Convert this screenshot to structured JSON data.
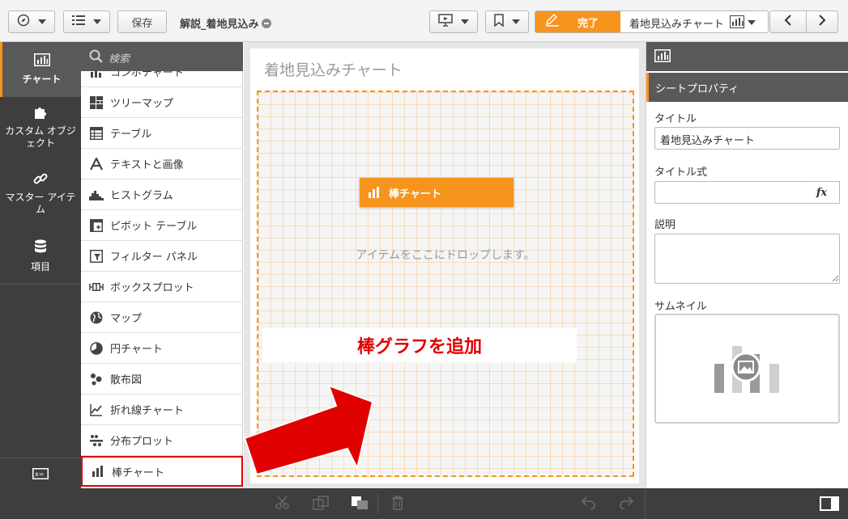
{
  "toolbar": {
    "explore_icon": "compass-icon",
    "menu_icon": "list-menu-icon",
    "save_label": "保存",
    "app_title": "解説_着地見込み",
    "present_icon": "presentation-icon",
    "bookmark_icon": "bookmark-icon",
    "edit_icon": "pencil-icon",
    "done_label": "完了",
    "sheet_name": "着地見込みチャート",
    "sheet_icon": "bar-chart-icon",
    "prev_icon": "chevron-left-icon",
    "next_icon": "chevron-right-icon"
  },
  "leftnav": {
    "items": [
      {
        "label": "チャート",
        "icon": "bar-chart-icon"
      },
      {
        "label": "カスタム オブジェクト",
        "icon": "puzzle-icon"
      },
      {
        "label": "マスター アイテム",
        "icon": "link-icon"
      },
      {
        "label": "項目",
        "icon": "database-icon"
      }
    ]
  },
  "list": {
    "search_placeholder": "検索",
    "items": [
      {
        "label": "コンボチャート",
        "icon": "combo-chart-icon"
      },
      {
        "label": "ツリーマップ",
        "icon": "treemap-icon"
      },
      {
        "label": "テーブル",
        "icon": "table-icon"
      },
      {
        "label": "テキストと画像",
        "icon": "text-image-icon"
      },
      {
        "label": "ヒストグラム",
        "icon": "histogram-icon"
      },
      {
        "label": "ピボット テーブル",
        "icon": "pivot-table-icon"
      },
      {
        "label": "フィルター パネル",
        "icon": "filter-pane-icon"
      },
      {
        "label": "ボックスプロット",
        "icon": "boxplot-icon"
      },
      {
        "label": "マップ",
        "icon": "globe-icon"
      },
      {
        "label": "円チャート",
        "icon": "pie-chart-icon"
      },
      {
        "label": "散布図",
        "icon": "scatter-plot-icon"
      },
      {
        "label": "折れ線チャート",
        "icon": "line-chart-icon"
      },
      {
        "label": "分布プロット",
        "icon": "distribution-plot-icon"
      },
      {
        "label": "棒チャート",
        "icon": "bar-chart-icon"
      }
    ]
  },
  "canvas": {
    "sheet_title": "着地見込みチャート",
    "drag_chip_label": "棒チャート",
    "drop_hint": "アイテムをここにドロップします。",
    "annotation": "棒グラフを追加"
  },
  "rpanel": {
    "tab_label": "シートプロパティ",
    "title_label": "タイトル",
    "title_value": "着地見込みチャート",
    "title_expr_label": "タイトル式",
    "title_expr_value": "",
    "fx_label": "fx",
    "desc_label": "説明",
    "desc_value": "",
    "thumb_label": "サムネイル"
  },
  "colors": {
    "accent": "#f7941d",
    "annotation_red": "#e00000",
    "nav_dark": "#3e3e3e",
    "nav_mid": "#595959"
  }
}
